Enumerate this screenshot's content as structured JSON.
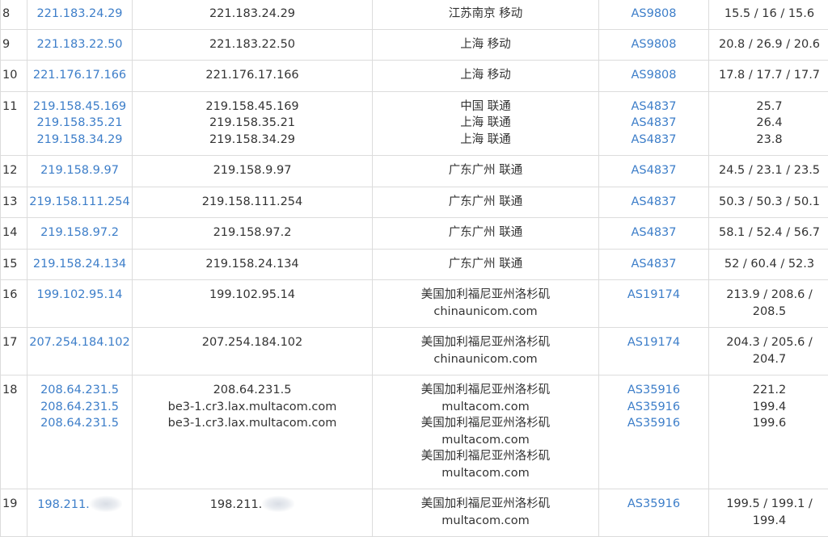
{
  "rows": [
    {
      "hop": "8",
      "ips": [
        "221.183.24.29"
      ],
      "hosts": [
        "221.183.24.29"
      ],
      "locations": [
        "江苏南京 移动"
      ],
      "as": [
        "AS9808"
      ],
      "ms": [
        "15.5 / 16 / 15.6"
      ]
    },
    {
      "hop": "9",
      "ips": [
        "221.183.22.50"
      ],
      "hosts": [
        "221.183.22.50"
      ],
      "locations": [
        "上海 移动"
      ],
      "as": [
        "AS9808"
      ],
      "ms": [
        "20.8 / 26.9 / 20.6"
      ]
    },
    {
      "hop": "10",
      "ips": [
        "221.176.17.166"
      ],
      "hosts": [
        "221.176.17.166"
      ],
      "locations": [
        "上海 移动"
      ],
      "as": [
        "AS9808"
      ],
      "ms": [
        "17.8 / 17.7 / 17.7"
      ]
    },
    {
      "hop": "11",
      "ips": [
        "219.158.45.169",
        "219.158.35.21",
        "219.158.34.29"
      ],
      "hosts": [
        "219.158.45.169",
        "219.158.35.21",
        "219.158.34.29"
      ],
      "locations": [
        "中国 联通",
        "上海 联通",
        "上海 联通"
      ],
      "as": [
        "AS4837",
        "AS4837",
        "AS4837"
      ],
      "ms": [
        "25.7",
        "26.4",
        "23.8"
      ]
    },
    {
      "hop": "12",
      "ips": [
        "219.158.9.97"
      ],
      "hosts": [
        "219.158.9.97"
      ],
      "locations": [
        "广东广州 联通"
      ],
      "as": [
        "AS4837"
      ],
      "ms": [
        "24.5 / 23.1 / 23.5"
      ]
    },
    {
      "hop": "13",
      "ips": [
        "219.158.111.254"
      ],
      "hosts": [
        "219.158.111.254"
      ],
      "locations": [
        "广东广州 联通"
      ],
      "as": [
        "AS4837"
      ],
      "ms": [
        "50.3 / 50.3 / 50.1"
      ]
    },
    {
      "hop": "14",
      "ips": [
        "219.158.97.2"
      ],
      "hosts": [
        "219.158.97.2"
      ],
      "locations": [
        "广东广州 联通"
      ],
      "as": [
        "AS4837"
      ],
      "ms": [
        "58.1 / 52.4 / 56.7"
      ]
    },
    {
      "hop": "15",
      "ips": [
        "219.158.24.134"
      ],
      "hosts": [
        "219.158.24.134"
      ],
      "locations": [
        "广东广州 联通"
      ],
      "as": [
        "AS4837"
      ],
      "ms": [
        "52 / 60.4 / 52.3"
      ]
    },
    {
      "hop": "16",
      "ips": [
        "199.102.95.14"
      ],
      "hosts": [
        "199.102.95.14"
      ],
      "locations": [
        "美国加利福尼亚州洛杉矶",
        "chinaunicom.com"
      ],
      "as": [
        "AS19174"
      ],
      "ms": [
        "213.9 / 208.6 /",
        "208.5"
      ]
    },
    {
      "hop": "17",
      "ips": [
        "207.254.184.102"
      ],
      "hosts": [
        "207.254.184.102"
      ],
      "locations": [
        "美国加利福尼亚州洛杉矶",
        "chinaunicom.com"
      ],
      "as": [
        "AS19174"
      ],
      "ms": [
        "204.3 / 205.6 /",
        "204.7"
      ]
    },
    {
      "hop": "18",
      "ips": [
        "208.64.231.5",
        "208.64.231.5",
        "208.64.231.5"
      ],
      "hosts": [
        "208.64.231.5",
        "be3-1.cr3.lax.multacom.com",
        "be3-1.cr3.lax.multacom.com"
      ],
      "locations": [
        "美国加利福尼亚州洛杉矶",
        "multacom.com",
        "美国加利福尼亚州洛杉矶",
        "multacom.com",
        "美国加利福尼亚州洛杉矶",
        "multacom.com"
      ],
      "as": [
        "AS35916",
        "AS35916",
        "AS35916"
      ],
      "ms": [
        "221.2",
        "199.4",
        "199.6"
      ]
    },
    {
      "hop": "19",
      "ips": [
        "198.211."
      ],
      "hosts": [
        "198.211."
      ],
      "locations": [
        "美国加利福尼亚州洛杉矶",
        "multacom.com"
      ],
      "as": [
        "AS35916"
      ],
      "ms": [
        "199.5 / 199.1 /",
        "199.4"
      ]
    }
  ],
  "colors": {
    "link": "#3d7ec9",
    "text": "#333333",
    "border": "#dcdcdc"
  }
}
